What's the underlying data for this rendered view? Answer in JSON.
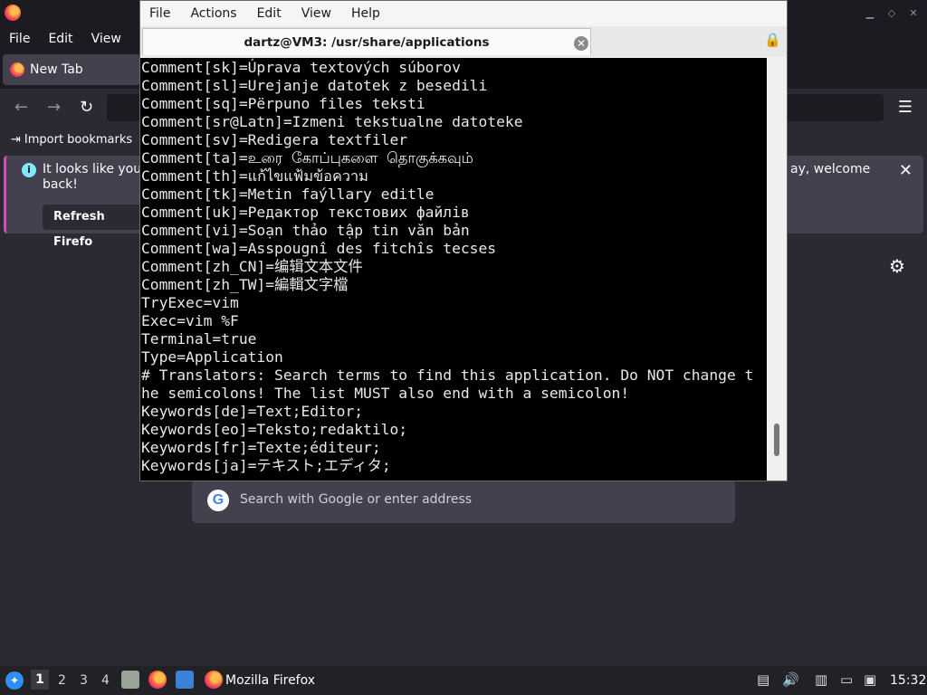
{
  "firefox": {
    "menu": [
      "File",
      "Edit",
      "View"
    ],
    "tab_label": "New Tab",
    "bookmarks_import": "Import bookmarks",
    "info_text": "It looks like you l",
    "info_text_line2": "back!",
    "info_text_right": "ay, welcome",
    "refresh_label": "Refresh Firefo",
    "search_placeholder": "Search with Google or enter address"
  },
  "terminal": {
    "menu": [
      "File",
      "Actions",
      "Edit",
      "View",
      "Help"
    ],
    "tab_title": "dartz@VM3: /usr/share/applications",
    "lines": [
      "Comment[sk]=Úprava textových súborov",
      "Comment[sl]=Urejanje datotek z besedili",
      "Comment[sq]=Përpuno files teksti",
      "Comment[sr@Latn]=Izmeni tekstualne datoteke",
      "Comment[sv]=Redigera textfiler",
      "Comment[ta]=உரை கோப்புகளை தொகுக்கவும்",
      "Comment[th]=แก้ไขแฟ้มข้อความ",
      "Comment[tk]=Metin faýllary editle",
      "Comment[uk]=Редактор текстових файлів",
      "Comment[vi]=Soạn thảo tập tin văn bản",
      "Comment[wa]=Asspougnî des fitchîs tecses",
      "Comment[zh_CN]=编辑文本文件",
      "Comment[zh_TW]=編輯文字檔",
      "TryExec=vim",
      "Exec=vim %F",
      "Terminal=true",
      "Type=Application",
      "# Translators: Search terms to find this application. Do NOT change t",
      "he semicolons! The list MUST also end with a semicolon!",
      "Keywords[de]=Text;Editor;",
      "Keywords[eo]=Teksto;redaktilo;",
      "Keywords[fr]=Texte;éditeur;",
      "Keywords[ja]=テキスト;エディタ;"
    ]
  },
  "taskbar": {
    "workspaces": [
      "1",
      "2",
      "3",
      "4"
    ],
    "task_label": "Mozilla Firefox",
    "clock": "15:32"
  }
}
